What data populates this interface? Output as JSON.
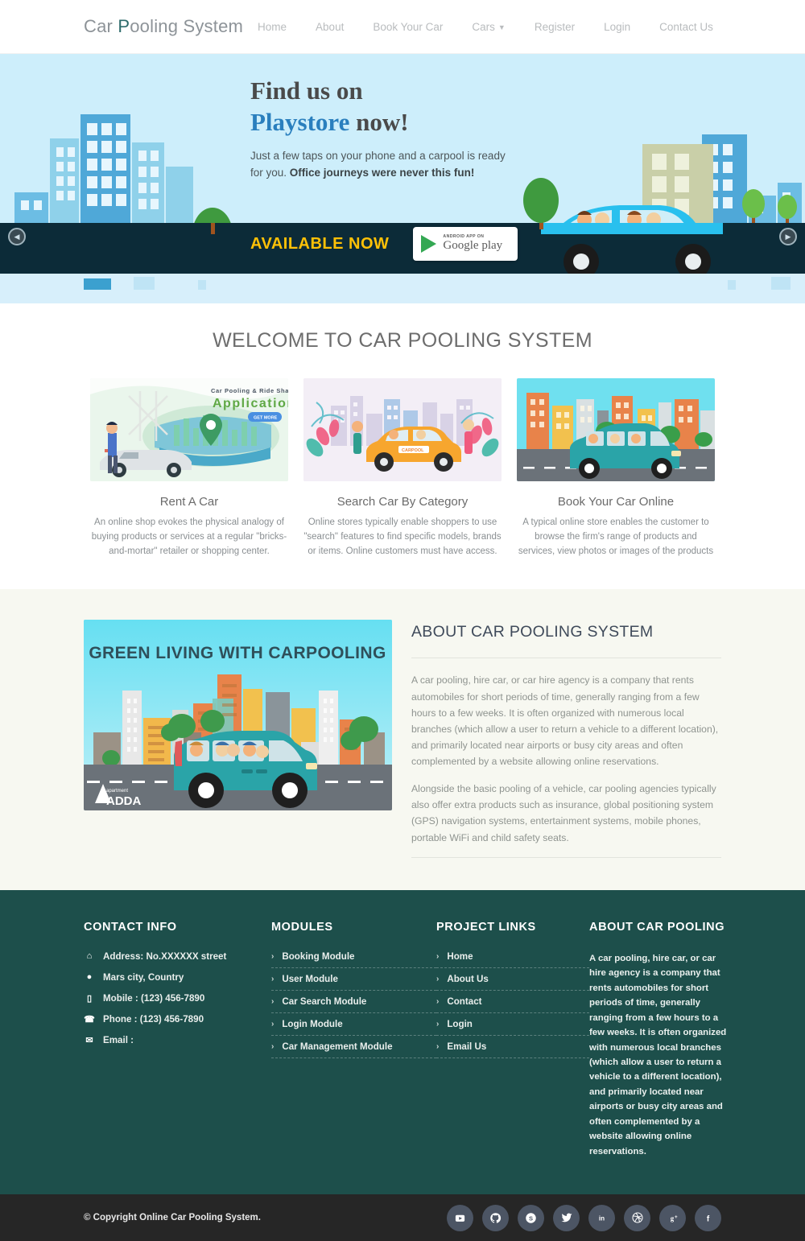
{
  "header": {
    "brand": {
      "part1": "Car ",
      "part2": "P",
      "part3": "ooling System"
    },
    "nav": [
      {
        "label": "Home",
        "has_caret": false
      },
      {
        "label": "About",
        "has_caret": false
      },
      {
        "label": "Book Your Car",
        "has_caret": false
      },
      {
        "label": "Cars",
        "has_caret": true
      },
      {
        "label": "Register",
        "has_caret": false
      },
      {
        "label": "Login",
        "has_caret": false
      },
      {
        "label": "Contact Us",
        "has_caret": false
      }
    ]
  },
  "hero": {
    "title_line1": "Find us on",
    "title_line2_highlight": "Playstore",
    "title_line2_rest": " now!",
    "subtitle_normal": "Just a few taps on your phone and a carpool is ready for you. ",
    "subtitle_bold": "Office journeys were never this fun!",
    "available_now": "AVAILABLE NOW",
    "store_badge_small": "ANDROID APP ON",
    "store_badge_large": "Google play",
    "prev_arrow": "◀",
    "next_arrow": "▶"
  },
  "welcome": {
    "heading": "WELCOME TO CAR POOLING SYSTEM",
    "cards": [
      {
        "title": "Rent A Car",
        "text": "An online shop evokes the physical analogy of buying products or services at a regular \"bricks-and-mortar\" retailer or shopping center.",
        "image_caption_small": "Car Pooling & Ride Sharing",
        "image_caption_large": "Application",
        "image_button": "GET MORE"
      },
      {
        "title": "Search Car By Category",
        "text": "Online stores typically enable shoppers to use \"search\" features to find specific models, brands or items. Online customers must have access.",
        "image_caption_small": "CARPOOL"
      },
      {
        "title": "Book Your Car Online",
        "text": "A typical online store enables the customer to browse the firm's range of products and services, view photos or images of the products"
      }
    ]
  },
  "about": {
    "image_title": "GREEN LIVING WITH CARPOOLING",
    "image_logo_small": "apartment",
    "image_logo_large": "ADDA",
    "heading": "ABOUT CAR POOLING SYSTEM",
    "paragraph1": "A car pooling, hire car, or car hire agency is a company that rents automobiles for short periods of time, generally ranging from a few hours to a few weeks. It is often organized with numerous local branches (which allow a user to return a vehicle to a different location), and primarily located near airports or busy city areas and often complemented by a website allowing online reservations.",
    "paragraph2": "Alongside the basic pooling of a vehicle, car pooling agencies typically also offer extra products such as insurance, global positioning system (GPS) navigation systems, entertainment systems, mobile phones, portable WiFi and child safety seats."
  },
  "footer": {
    "contact": {
      "heading": "CONTACT INFO",
      "items": [
        {
          "icon": "home-icon",
          "glyph": "⌂",
          "text": "Address: No.XXXXXX street"
        },
        {
          "icon": "globe-icon",
          "glyph": "●",
          "text": "Mars city, Country"
        },
        {
          "icon": "mobile-icon",
          "glyph": "▯",
          "text": "Mobile : (123) 456-7890"
        },
        {
          "icon": "phone-icon",
          "glyph": "☎",
          "text": "Phone : (123) 456-7890"
        },
        {
          "icon": "envelope-icon",
          "glyph": "✉",
          "text": "Email :"
        }
      ]
    },
    "modules": {
      "heading": "MODULES",
      "items": [
        "Booking Module",
        "User Module",
        "Car Search Module",
        "Login Module",
        "Car Management Module"
      ]
    },
    "project_links": {
      "heading": "PROJECT LINKS",
      "items": [
        "Home",
        "About Us",
        "Contact",
        "Login",
        "Email Us"
      ]
    },
    "about": {
      "heading": "ABOUT CAR POOLING",
      "text": "A car pooling, hire car, or car hire agency is a company that rents automobiles for short periods of time, generally ranging from a few hours to a few weeks. It is often organized with numerous local branches (which allow a user to return a vehicle to a different location), and primarily located near airports or busy city areas and often complemented by a website allowing online reservations."
    }
  },
  "copyright": {
    "text": "© Copyright Online Car Pooling System.",
    "socials": [
      {
        "name": "youtube-icon",
        "glyph": "▶"
      },
      {
        "name": "github-icon",
        "glyph": "●"
      },
      {
        "name": "skype-icon",
        "glyph": "S"
      },
      {
        "name": "twitter-icon",
        "glyph": "✉"
      },
      {
        "name": "linkedin-icon",
        "glyph": "in"
      },
      {
        "name": "dribbble-icon",
        "glyph": "⊕"
      },
      {
        "name": "googleplus-icon",
        "glyph": "g+"
      },
      {
        "name": "facebook-icon",
        "glyph": "f"
      }
    ]
  },
  "colors": {
    "brand_teal": "#2d6b6b",
    "footer_bg": "#1d4f4b",
    "copybar_bg": "#262626",
    "hero_sky": "#cdeefb",
    "hero_road": "#0c2b38",
    "accent_yellow": "#ffc107",
    "playstore_blue": "#2a7fbe"
  }
}
